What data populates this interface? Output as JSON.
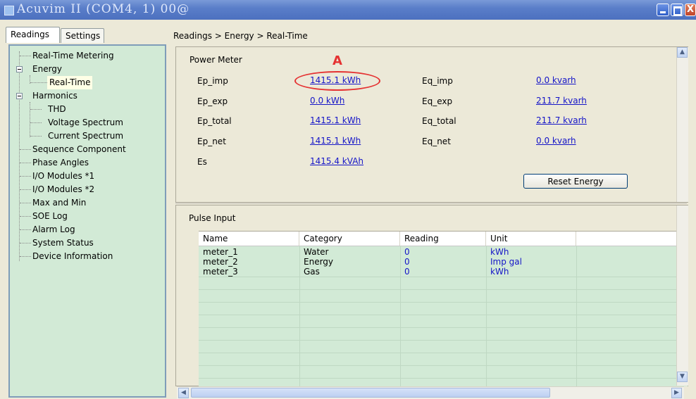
{
  "window": {
    "title": "Acuvim II  (COM4, 1)  00@",
    "close_glyph": "X"
  },
  "tabs": [
    "Readings",
    "Settings"
  ],
  "breadcrumb": "Readings > Energy > Real-Time",
  "tree": [
    "Real-Time Metering",
    "Energy",
    "Real-Time",
    "Harmonics",
    "THD",
    "Voltage Spectrum",
    "Current Spectrum",
    "Sequence Component",
    "Phase Angles",
    "I/O Modules *1",
    "I/O Modules *2",
    "Max and Min",
    "SOE Log",
    "Alarm Log",
    "System Status",
    "Device Information"
  ],
  "power_meter": {
    "title": "Power Meter",
    "ep_imp_label": "Ep_imp",
    "ep_imp": "1415.1 kWh",
    "eq_imp_label": "Eq_imp",
    "eq_imp": "0.0 kvarh",
    "ep_exp_label": "Ep_exp",
    "ep_exp": "0.0 kWh",
    "eq_exp_label": "Eq_exp",
    "eq_exp": "211.7 kvarh",
    "ep_total_label": "Ep_total",
    "ep_total": "1415.1 kWh",
    "eq_total_label": "Eq_total",
    "eq_total": "211.7 kvarh",
    "ep_net_label": "Ep_net",
    "ep_net": "1415.1 kWh",
    "eq_net_label": "Eq_net",
    "eq_net": "0.0 kvarh",
    "es_label": "Es",
    "es": "1415.4 kVAh",
    "reset_button": "Reset Energy",
    "annotation_letter": "A"
  },
  "pulse_input": {
    "title": "Pulse Input",
    "columns": [
      "Name",
      "Category",
      "Reading",
      "Unit"
    ],
    "rows": [
      [
        "meter_1",
        "Water",
        "0",
        "kWh"
      ],
      [
        "meter_2",
        "Energy",
        "0",
        "Imp gal"
      ],
      [
        "meter_3",
        "Gas",
        "0",
        "kWh"
      ]
    ]
  },
  "icons": {
    "scroll_up": "chevron-up-icon",
    "scroll_down": "chevron-down-icon",
    "scroll_left": "chevron-left-icon",
    "scroll_right": "chevron-right-icon"
  },
  "colors": {
    "tree_bg": "#d2ead6",
    "link": "#1515c8",
    "annotation": "#e53232",
    "titlebar": "#5a7ec9"
  }
}
